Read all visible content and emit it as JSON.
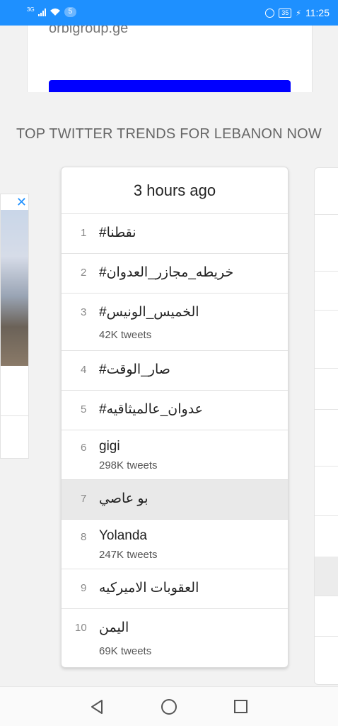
{
  "status_bar": {
    "network": "3G",
    "badge": "5",
    "battery": "35",
    "time": "11:25",
    "icons": [
      "signal-icon",
      "wifi-icon",
      "alarm-icon",
      "battery-icon",
      "charging-icon"
    ]
  },
  "ad": {
    "url": "orbigroup.ge",
    "button_color": "#0000ff"
  },
  "section_title": "TOP TWITTER TRENDS FOR LEBANON NOW",
  "card": {
    "header": "3 hours ago",
    "trends": [
      {
        "rank": "1",
        "name": "#نقطنا",
        "tweets": ""
      },
      {
        "rank": "2",
        "name": "#خريطه_مجازر_العدوان",
        "tweets": ""
      },
      {
        "rank": "3",
        "name": "#الخميس_الونيس",
        "tweets": "42K tweets"
      },
      {
        "rank": "4",
        "name": "#صار_الوقت",
        "tweets": ""
      },
      {
        "rank": "5",
        "name": "#عدوان_عالميثاقيه",
        "tweets": ""
      },
      {
        "rank": "6",
        "name": "gigi",
        "tweets": "298K tweets"
      },
      {
        "rank": "7",
        "name": "بو عاصي",
        "tweets": ""
      },
      {
        "rank": "8",
        "name": "Yolanda",
        "tweets": "247K tweets"
      },
      {
        "rank": "9",
        "name": "العقوبات الاميركيه",
        "tweets": ""
      },
      {
        "rank": "10",
        "name": "اليمن",
        "tweets": "69K tweets"
      }
    ]
  },
  "side_ad": {
    "close_glyph": "✕"
  },
  "colors": {
    "status_bar": "#1e90ff",
    "highlight_row": "#e9e9e9"
  }
}
